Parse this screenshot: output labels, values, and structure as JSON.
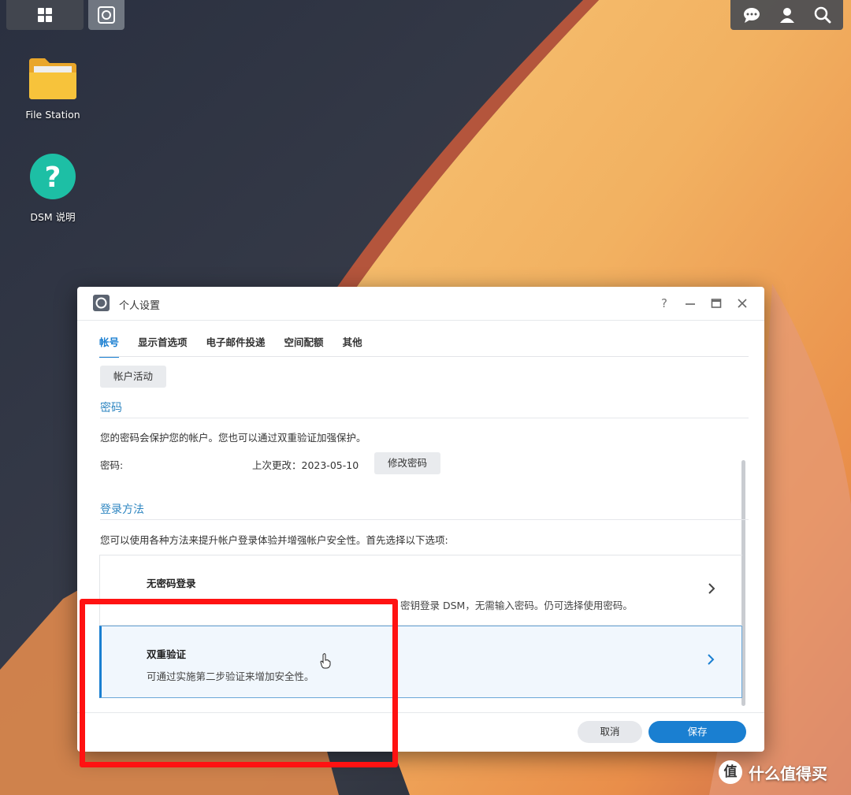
{
  "desktop": {
    "icons": [
      {
        "label": "File Station",
        "icon": "folder-icon"
      },
      {
        "label": "DSM 说明",
        "icon": "help-icon"
      }
    ],
    "tray_icons": [
      "chat-icon",
      "user-icon",
      "search-icon"
    ]
  },
  "dialog": {
    "title": "个人设置",
    "tabs": [
      {
        "label": "帐号",
        "active": true
      },
      {
        "label": "显示首选项"
      },
      {
        "label": "电子邮件投递"
      },
      {
        "label": "空间配额"
      },
      {
        "label": "其他"
      }
    ],
    "account_activity_button": "帐户活动",
    "password_section": {
      "title": "密码",
      "description": "您的密码会保护您的帐户。您也可以通过双重验证加强保护。",
      "label": "密码:",
      "last_changed": "上次更改：2023-05-10",
      "change_button": "修改密码"
    },
    "login_section": {
      "title": "登录方法",
      "description": "您可以使用各种方法来提升帐户登录体验并增强帐户安全性。首先选择以下选项:",
      "options": [
        {
          "title": "无密码登录",
          "description": "密钥登录 DSM，无需输入密码。仍可选择使用密码。",
          "selected": false
        },
        {
          "title": "双重验证",
          "description": "可通过实施第二步验证来增加安全性。",
          "selected": true
        }
      ]
    },
    "footer": {
      "cancel": "取消",
      "save": "保存"
    }
  },
  "watermark": {
    "icon_text": "值",
    "text": "什么值得买"
  },
  "colors": {
    "accent": "#1a7fd1",
    "highlight": "#ff1212",
    "section_title": "#2e86c1"
  }
}
